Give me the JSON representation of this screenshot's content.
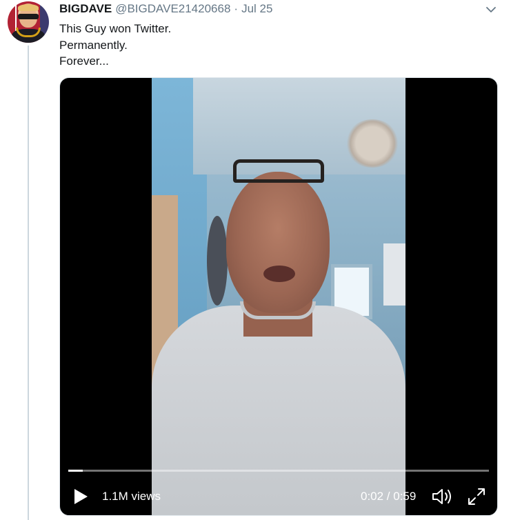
{
  "tweet": {
    "author_name": "BIGDAVE",
    "author_handle": "@BIGDAVE21420668",
    "separator": "·",
    "date": "Jul 25",
    "text_lines": [
      "This Guy won Twitter.",
      "Permanently.",
      "Forever..."
    ]
  },
  "video": {
    "views": "1.1M views",
    "time": "0:02 / 0:59",
    "progress_fraction": 0.034
  },
  "icons": {
    "caret": "chevron-down-icon",
    "play": "play-icon",
    "volume": "volume-icon",
    "fullscreen": "fullscreen-icon"
  },
  "colors": {
    "text_primary": "#14171a",
    "text_secondary": "#657786",
    "thread_line": "#ccd6dd"
  }
}
